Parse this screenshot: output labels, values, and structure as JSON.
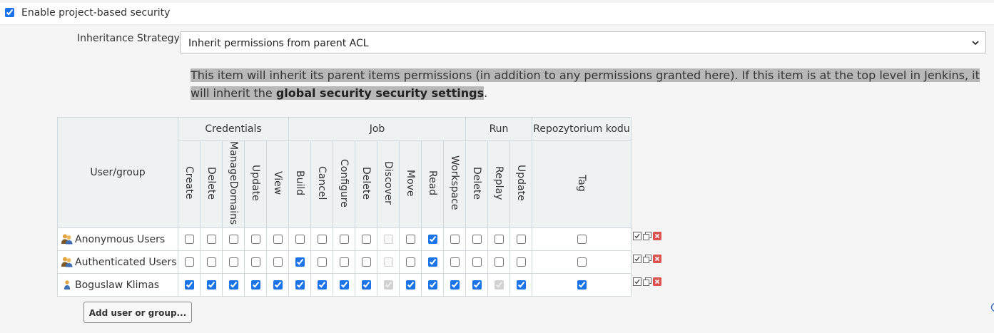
{
  "enable": {
    "label": "Enable project-based security",
    "checked": true
  },
  "strategy": {
    "label": "Inheritance Strategy",
    "value": "Inherit permissions from parent ACL"
  },
  "help": {
    "pre": "This item will inherit its parent items permissions (in addition to any permissions granted here). If this item is at the top level in Jenkins, it will inherit the ",
    "bold": "global security security settings",
    "post": "."
  },
  "table": {
    "user_group_header": "User/group",
    "groups": [
      {
        "name": "Credentials",
        "perms": [
          "Create",
          "Delete",
          "ManageDomains",
          "Update",
          "View"
        ]
      },
      {
        "name": "Job",
        "perms": [
          "Build",
          "Cancel",
          "Configure",
          "Delete",
          "Discover",
          "Move",
          "Read",
          "Workspace"
        ]
      },
      {
        "name": "Run",
        "perms": [
          "Delete",
          "Replay",
          "Update"
        ]
      },
      {
        "name": "Repozytorium kodu",
        "perms": [
          "Tag"
        ]
      }
    ],
    "rows": [
      {
        "name": "Anonymous Users",
        "icon": "users-group-icon",
        "checks": [
          false,
          false,
          false,
          false,
          false,
          false,
          false,
          false,
          false,
          false,
          false,
          true,
          false,
          false,
          false,
          false,
          false
        ],
        "disabled": [
          false,
          false,
          false,
          false,
          false,
          false,
          false,
          false,
          false,
          true,
          false,
          false,
          false,
          false,
          false,
          false,
          false
        ]
      },
      {
        "name": "Authenticated Users",
        "icon": "users-group-icon",
        "checks": [
          false,
          false,
          false,
          false,
          false,
          true,
          false,
          false,
          false,
          false,
          false,
          true,
          false,
          false,
          false,
          false,
          false
        ],
        "disabled": [
          false,
          false,
          false,
          false,
          false,
          false,
          false,
          false,
          false,
          true,
          false,
          false,
          false,
          false,
          false,
          false,
          false
        ]
      },
      {
        "name": "Boguslaw Klimas",
        "icon": "user-icon",
        "checks": [
          true,
          true,
          true,
          true,
          true,
          true,
          true,
          true,
          true,
          true,
          true,
          true,
          true,
          true,
          true,
          true,
          true
        ],
        "disabled": [
          false,
          false,
          false,
          false,
          false,
          false,
          false,
          false,
          false,
          true,
          false,
          false,
          false,
          false,
          true,
          false,
          false
        ]
      }
    ]
  },
  "add_button": "Add user or group...",
  "colors": {
    "accent": "#1a73e8",
    "highlight": "#b8b8b8",
    "header_bg": "#eef2f2",
    "delete_red": "#d9534f"
  }
}
